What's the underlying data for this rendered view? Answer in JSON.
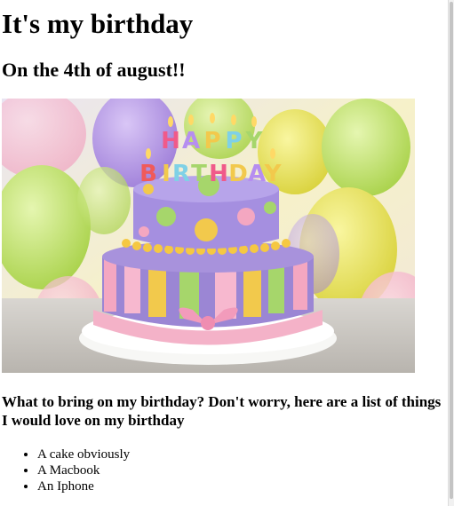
{
  "page": {
    "heading": "It's my birthday",
    "subheading": "On the 4th of august!!",
    "image": {
      "description_icon": "birthday-cake-photo",
      "candle_letters_top": [
        "H",
        "A",
        "P",
        "P",
        "Y"
      ],
      "candle_letters_bottom": [
        "B",
        "I",
        "R",
        "T",
        "H",
        "D",
        "A",
        "Y"
      ]
    },
    "wishlist_intro": "What to bring on my birthday? Don't worry, here are a list of things I would love on my birthday",
    "wishlist": [
      "A cake obviously",
      "A Macbook",
      "An Iphone"
    ]
  },
  "colors": {
    "text": "#000000",
    "background": "#ffffff",
    "cake_purple": "#9b86d4",
    "cake_pink": "#f4a7c1",
    "cake_yellow": "#f2c94c",
    "cake_green": "#a6d66b"
  }
}
